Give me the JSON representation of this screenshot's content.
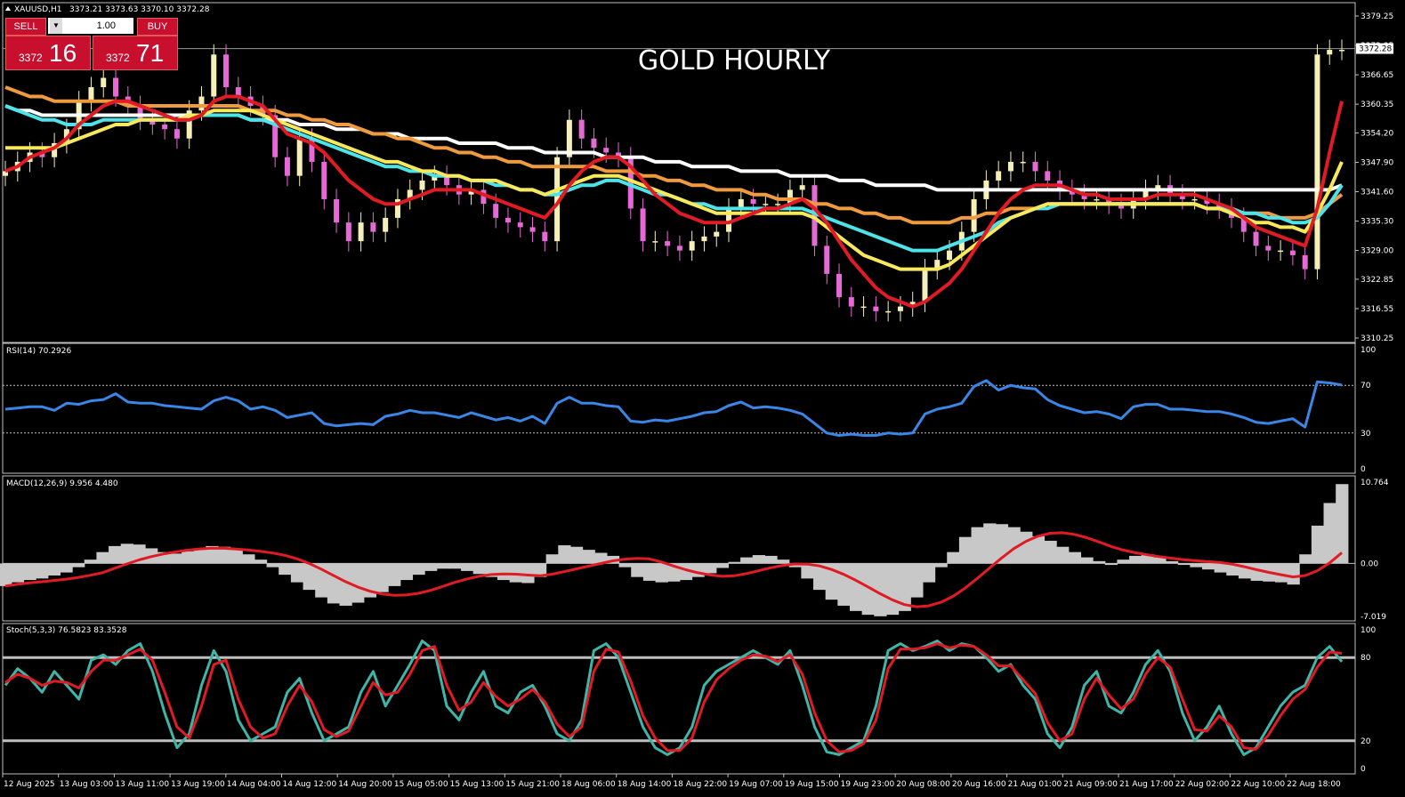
{
  "header": {
    "symbol": "XAUUSD,H1",
    "ohlc": "3373.21 3373.63 3370.10 3372.28",
    "title": "GOLD HOURLY"
  },
  "trade_panel": {
    "sell_label": "SELL",
    "buy_label": "BUY",
    "lot": "1.00",
    "sell_price_small": "3372",
    "sell_price_big": "16",
    "buy_price_small": "3372",
    "buy_price_big": "71"
  },
  "colors": {
    "bull_candle": "#f5f0b8",
    "bear_candle": "#e56ad6",
    "ma_red": "#e01b24",
    "ma_yellow": "#f7e85c",
    "ma_cyan": "#4de3e8",
    "ma_orange": "#f09a3e",
    "ma_white": "#ffffff",
    "rsi": "#3a86e6",
    "macd_hist": "#c8c8c8",
    "macd_signal": "#e01b24",
    "stoch_main": "#3fb5a8",
    "stoch_signal": "#e01b24"
  },
  "chart_data": [
    {
      "type": "candlestick",
      "panel": "price",
      "title": "GOLD HOURLY",
      "price_axis_ticks": [
        "3379.25",
        "3372.95",
        "3366.65",
        "3360.35",
        "3354.20",
        "3347.90",
        "3341.60",
        "3335.30",
        "3329.00",
        "3322.85",
        "3316.55",
        "3310.25"
      ],
      "current_price": "3372.28",
      "ylim": [
        3310.25,
        3379.25
      ],
      "series": [
        {
          "name": "close",
          "values": [
            3346,
            3348,
            3350,
            3349,
            3352,
            3355,
            3361,
            3364,
            3366,
            3362,
            3360,
            3357,
            3356,
            3355,
            3353,
            3359,
            3362,
            3371,
            3364,
            3362,
            3360,
            3358,
            3349,
            3345,
            3353,
            3348,
            3340,
            3335,
            3331,
            3335,
            3333,
            3336,
            3340,
            3342,
            3344,
            3345,
            3343,
            3341,
            3342,
            3339,
            3336,
            3335,
            3334,
            3333,
            3331,
            3349,
            3357,
            3353,
            3351,
            3350,
            3349,
            3338,
            3331,
            3331,
            3330,
            3329,
            3331,
            3332,
            3333,
            3338,
            3340,
            3339,
            3339,
            3339,
            3342,
            3343,
            3330,
            3324,
            3319,
            3317,
            3317,
            3316,
            3316,
            3317,
            3318,
            3325,
            3327,
            3329,
            3333,
            3340,
            3344,
            3346,
            3348,
            3348,
            3346,
            3344,
            3342,
            3341,
            3340,
            3340,
            3339,
            3338,
            3340,
            3342,
            3343,
            3341,
            3340,
            3340,
            3339,
            3338,
            3336,
            3333,
            3330,
            3329,
            3329,
            3328,
            3325,
            3371,
            3372,
            3372
          ]
        }
      ]
    },
    {
      "type": "line",
      "panel": "rsi",
      "title": "RSI(14) 70.2926",
      "ylim": [
        0,
        100
      ],
      "levels": [
        30,
        70
      ],
      "axis_ticks": [
        "100",
        "70",
        "30",
        "0"
      ],
      "values": [
        50,
        51,
        52,
        52,
        49,
        55,
        54,
        57,
        58,
        63,
        56,
        55,
        55,
        53,
        52,
        51,
        50,
        57,
        60,
        57,
        50,
        52,
        49,
        43,
        45,
        47,
        38,
        36,
        37,
        38,
        37,
        44,
        46,
        49,
        47,
        47,
        45,
        43,
        47,
        44,
        41,
        43,
        40,
        44,
        38,
        55,
        60,
        55,
        55,
        53,
        52,
        40,
        39,
        41,
        40,
        42,
        44,
        47,
        48,
        53,
        56,
        51,
        52,
        51,
        49,
        46,
        38,
        30,
        28,
        29,
        28,
        28,
        30,
        29,
        30,
        46,
        50,
        52,
        55,
        69,
        74,
        66,
        70,
        68,
        67,
        58,
        53,
        50,
        47,
        48,
        46,
        42,
        52,
        54,
        54,
        50,
        50,
        49,
        48,
        48,
        46,
        43,
        39,
        38,
        40,
        42,
        35,
        73,
        72,
        70.3
      ]
    },
    {
      "type": "bar+line",
      "panel": "macd",
      "title": "MACD(12,26,9) 9.956 4.480",
      "ylim": [
        -7.019,
        10.764
      ],
      "axis_ticks": [
        "10.764",
        "0.00",
        "-7.019"
      ],
      "histogram": [
        -3,
        -2.5,
        -2.2,
        -2,
        -1.6,
        -1.2,
        -0.5,
        0.5,
        1.5,
        2.3,
        2.6,
        2.5,
        2,
        1.5,
        1.3,
        1.6,
        2,
        2.3,
        2.2,
        1.8,
        1.2,
        0.5,
        -0.5,
        -1.5,
        -2.5,
        -3.5,
        -4.5,
        -5.3,
        -5.6,
        -5.2,
        -4.5,
        -3.8,
        -3,
        -2.2,
        -1.5,
        -1,
        -0.7,
        -0.7,
        -1,
        -1.4,
        -1.8,
        -2.2,
        -2.5,
        -2.6,
        -1.8,
        1.2,
        2.4,
        2.2,
        1.8,
        1.4,
        1,
        -0.5,
        -1.8,
        -2.3,
        -2.5,
        -2.4,
        -2.2,
        -1.8,
        -1.3,
        -0.6,
        0.2,
        0.8,
        1.1,
        1,
        0.5,
        -0.5,
        -2,
        -3.5,
        -4.8,
        -5.6,
        -6.3,
        -6.8,
        -7,
        -6.8,
        -6.3,
        -4.5,
        -2.5,
        -0.5,
        1.5,
        3.5,
        4.8,
        5.3,
        5.2,
        4.8,
        4.2,
        3.6,
        3,
        2.2,
        1.5,
        0.8,
        0.3,
        -0.2,
        0.5,
        1,
        1.2,
        0.8,
        0.3,
        -0.2,
        -0.5,
        -0.8,
        -1.2,
        -1.6,
        -2,
        -2.3,
        -2.4,
        -2.5,
        -2.8,
        1.2,
        5,
        8,
        10.5
      ]
    },
    {
      "type": "line",
      "panel": "stoch",
      "title": "Stoch(5,3,3) 76.5823 83.3528",
      "ylim": [
        0,
        100
      ],
      "levels": [
        20,
        80
      ],
      "axis_ticks": [
        "100",
        "80",
        "20",
        "0"
      ],
      "series": [
        {
          "name": "main",
          "values": [
            60,
            72,
            65,
            55,
            70,
            60,
            50,
            78,
            82,
            75,
            85,
            90,
            70,
            40,
            15,
            25,
            60,
            85,
            70,
            35,
            20,
            25,
            30,
            55,
            65,
            40,
            20,
            25,
            30,
            55,
            70,
            45,
            60,
            75,
            92,
            85,
            45,
            35,
            55,
            70,
            45,
            40,
            55,
            60,
            45,
            25,
            20,
            35,
            85,
            90,
            80,
            55,
            30,
            15,
            10,
            15,
            30,
            60,
            70,
            75,
            80,
            85,
            80,
            75,
            85,
            60,
            30,
            12,
            10,
            15,
            20,
            45,
            85,
            90,
            85,
            88,
            92,
            85,
            90,
            88,
            80,
            70,
            75,
            60,
            50,
            25,
            15,
            30,
            60,
            70,
            45,
            40,
            55,
            75,
            85,
            70,
            40,
            20,
            30,
            45,
            25,
            10,
            15,
            30,
            45,
            55,
            60,
            80,
            88,
            77
          ]
        },
        {
          "name": "signal",
          "values": [
            62,
            68,
            65,
            60,
            63,
            62,
            58,
            70,
            78,
            78,
            82,
            86,
            78,
            55,
            30,
            22,
            45,
            75,
            78,
            50,
            30,
            22,
            25,
            45,
            60,
            48,
            28,
            23,
            27,
            45,
            62,
            53,
            55,
            68,
            85,
            88,
            60,
            42,
            48,
            62,
            52,
            45,
            50,
            57,
            48,
            32,
            23,
            30,
            70,
            86,
            84,
            63,
            38,
            22,
            13,
            13,
            22,
            48,
            64,
            72,
            78,
            82,
            81,
            77,
            82,
            68,
            40,
            20,
            12,
            13,
            18,
            35,
            72,
            86,
            86,
            87,
            90,
            87,
            89,
            88,
            82,
            74,
            74,
            64,
            54,
            33,
            20,
            25,
            50,
            65,
            53,
            43,
            50,
            68,
            80,
            73,
            50,
            28,
            27,
            38,
            30,
            15,
            14,
            24,
            38,
            50,
            57,
            73,
            84,
            83
          ]
        }
      ]
    },
    {
      "type": "axis",
      "panel": "time",
      "time_labels": [
        "12 Aug 2025",
        "13 Aug 03:00",
        "13 Aug 11:00",
        "13 Aug 19:00",
        "14 Aug 04:00",
        "14 Aug 12:00",
        "14 Aug 20:00",
        "15 Aug 05:00",
        "15 Aug 13:00",
        "15 Aug 21:00",
        "18 Aug 06:00",
        "18 Aug 14:00",
        "18 Aug 22:00",
        "19 Aug 07:00",
        "19 Aug 15:00",
        "19 Aug 23:00",
        "20 Aug 08:00",
        "20 Aug 16:00",
        "21 Aug 01:00",
        "21 Aug 09:00",
        "21 Aug 17:00",
        "22 Aug 02:00",
        "22 Aug 10:00",
        "22 Aug 18:00"
      ]
    }
  ],
  "moving_averages": {
    "red": [
      3346,
      3347,
      3349,
      3350,
      3351,
      3353,
      3356,
      3358,
      3360,
      3361,
      3361,
      3360,
      3359,
      3358,
      3357,
      3357,
      3358,
      3361,
      3362,
      3362,
      3361,
      3360,
      3357,
      3354,
      3353,
      3352,
      3350,
      3347,
      3344,
      3342,
      3340,
      3339,
      3339,
      3340,
      3341,
      3342,
      3342,
      3342,
      3342,
      3341,
      3340,
      3339,
      3338,
      3337,
      3336,
      3339,
      3343,
      3346,
      3348,
      3349,
      3349,
      3347,
      3344,
      3341,
      3339,
      3337,
      3336,
      3335,
      3335,
      3335,
      3336,
      3337,
      3338,
      3338,
      3339,
      3340,
      3338,
      3335,
      3331,
      3327,
      3324,
      3321,
      3319,
      3318,
      3317,
      3318,
      3320,
      3322,
      3325,
      3329,
      3333,
      3337,
      3340,
      3342,
      3343,
      3343,
      3343,
      3342,
      3341,
      3341,
      3340,
      3340,
      3340,
      3340,
      3341,
      3341,
      3341,
      3341,
      3340,
      3339,
      3338,
      3336,
      3334,
      3333,
      3332,
      3331,
      3330,
      3338,
      3350,
      3361
    ],
    "yellow": [
      3351,
      3351,
      3351,
      3351,
      3351,
      3352,
      3353,
      3354,
      3355,
      3356,
      3356,
      3357,
      3357,
      3357,
      3357,
      3358,
      3358,
      3359,
      3359,
      3359,
      3359,
      3358,
      3357,
      3356,
      3355,
      3354,
      3353,
      3352,
      3351,
      3350,
      3349,
      3348,
      3348,
      3347,
      3346,
      3346,
      3345,
      3345,
      3344,
      3344,
      3344,
      3343,
      3342,
      3342,
      3341,
      3342,
      3343,
      3344,
      3345,
      3345,
      3345,
      3344,
      3343,
      3342,
      3341,
      3340,
      3339,
      3338,
      3337,
      3337,
      3337,
      3337,
      3337,
      3337,
      3337,
      3337,
      3336,
      3334,
      3332,
      3330,
      3328,
      3327,
      3326,
      3325,
      3325,
      3325,
      3325,
      3326,
      3328,
      3330,
      3332,
      3334,
      3336,
      3337,
      3338,
      3339,
      3339,
      3339,
      3339,
      3339,
      3339,
      3339,
      3339,
      3339,
      3339,
      3339,
      3339,
      3339,
      3338,
      3338,
      3337,
      3336,
      3335,
      3335,
      3334,
      3334,
      3333,
      3337,
      3342,
      3348
    ],
    "cyan": [
      3360,
      3359,
      3358,
      3357,
      3357,
      3356,
      3356,
      3356,
      3357,
      3357,
      3357,
      3357,
      3357,
      3357,
      3357,
      3357,
      3358,
      3358,
      3358,
      3358,
      3357,
      3357,
      3356,
      3355,
      3354,
      3353,
      3352,
      3351,
      3350,
      3349,
      3348,
      3347,
      3347,
      3346,
      3346,
      3345,
      3345,
      3345,
      3344,
      3344,
      3343,
      3343,
      3342,
      3342,
      3341,
      3341,
      3342,
      3343,
      3343,
      3344,
      3344,
      3343,
      3342,
      3341,
      3341,
      3340,
      3339,
      3339,
      3338,
      3338,
      3338,
      3338,
      3338,
      3338,
      3338,
      3338,
      3337,
      3336,
      3335,
      3334,
      3333,
      3332,
      3331,
      3330,
      3329,
      3329,
      3329,
      3330,
      3331,
      3332,
      3333,
      3335,
      3336,
      3337,
      3338,
      3338,
      3339,
      3339,
      3339,
      3339,
      3339,
      3339,
      3339,
      3339,
      3339,
      3339,
      3339,
      3339,
      3338,
      3338,
      3338,
      3337,
      3337,
      3336,
      3336,
      3335,
      3335,
      3336,
      3339,
      3343
    ],
    "orange": [
      3364,
      3363,
      3362,
      3362,
      3361,
      3361,
      3361,
      3361,
      3361,
      3361,
      3360,
      3360,
      3360,
      3360,
      3360,
      3360,
      3360,
      3360,
      3360,
      3360,
      3359,
      3359,
      3359,
      3358,
      3358,
      3357,
      3357,
      3356,
      3356,
      3355,
      3354,
      3354,
      3353,
      3353,
      3352,
      3351,
      3351,
      3350,
      3350,
      3349,
      3349,
      3348,
      3348,
      3347,
      3347,
      3347,
      3347,
      3347,
      3347,
      3346,
      3346,
      3346,
      3345,
      3345,
      3344,
      3344,
      3343,
      3343,
      3342,
      3342,
      3342,
      3341,
      3341,
      3340,
      3340,
      3340,
      3339,
      3339,
      3338,
      3338,
      3337,
      3337,
      3336,
      3336,
      3335,
      3335,
      3335,
      3335,
      3336,
      3336,
      3337,
      3337,
      3338,
      3338,
      3338,
      3339,
      3339,
      3339,
      3339,
      3339,
      3339,
      3339,
      3339,
      3339,
      3339,
      3339,
      3339,
      3339,
      3338,
      3338,
      3338,
      3337,
      3337,
      3337,
      3336,
      3336,
      3336,
      3337,
      3339,
      3341
    ],
    "white": [
      3360,
      3359,
      3359,
      3358,
      3358,
      3358,
      3358,
      3358,
      3358,
      3358,
      3358,
      3358,
      3358,
      3358,
      3358,
      3358,
      3358,
      3358,
      3358,
      3358,
      3357,
      3357,
      3357,
      3357,
      3356,
      3356,
      3356,
      3355,
      3355,
      3355,
      3354,
      3354,
      3354,
      3353,
      3353,
      3353,
      3353,
      3352,
      3352,
      3352,
      3352,
      3351,
      3351,
      3351,
      3350,
      3350,
      3350,
      3350,
      3350,
      3349,
      3349,
      3349,
      3349,
      3348,
      3348,
      3348,
      3347,
      3347,
      3347,
      3347,
      3346,
      3346,
      3346,
      3346,
      3345,
      3345,
      3345,
      3345,
      3344,
      3344,
      3344,
      3343,
      3343,
      3343,
      3343,
      3343,
      3342,
      3342,
      3342,
      3342,
      3342,
      3342,
      3342,
      3342,
      3342,
      3342,
      3342,
      3342,
      3342,
      3342,
      3342,
      3342,
      3342,
      3342,
      3342,
      3342,
      3342,
      3342,
      3342,
      3342,
      3342,
      3342,
      3342,
      3342,
      3342,
      3342,
      3342,
      3342,
      3342,
      3343
    ]
  }
}
